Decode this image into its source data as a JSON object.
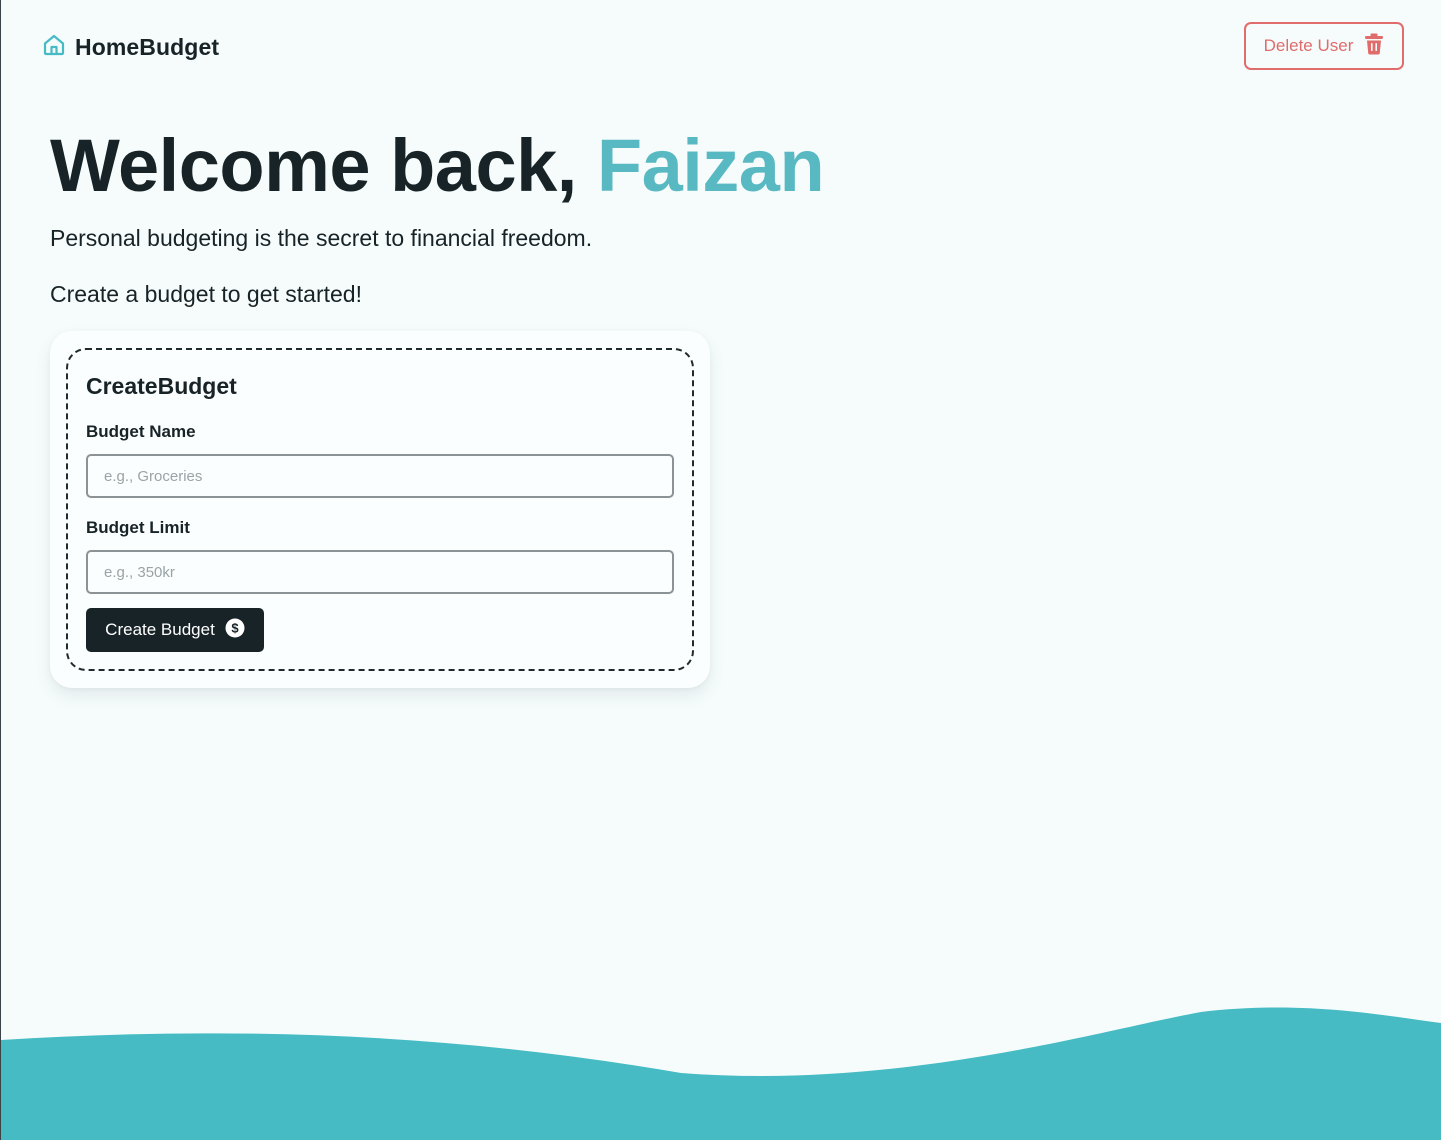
{
  "nav": {
    "brand": "HomeBudget",
    "brand_icon": "home-icon",
    "delete_user_label": "Delete User",
    "delete_icon": "trash-icon"
  },
  "hero": {
    "greeting": "Welcome back, ",
    "username": "Faizan",
    "subtitle": "Personal budgeting is the secret to financial freedom.",
    "cta_text": "Create a budget to get started!"
  },
  "create_budget": {
    "title": "CreateBudget",
    "name_label": "Budget Name",
    "name_placeholder": "e.g., Groceries",
    "name_value": "",
    "limit_label": "Budget Limit",
    "limit_placeholder": "e.g., 350kr",
    "limit_value": "",
    "submit_label": "Create Budget",
    "submit_icon": "dollar-circle-icon"
  },
  "colors": {
    "accent": "#59b9c3",
    "wave": "#46bbc4",
    "danger": "#e06c6c",
    "dark": "#182327",
    "background": "#f6fcfc"
  }
}
